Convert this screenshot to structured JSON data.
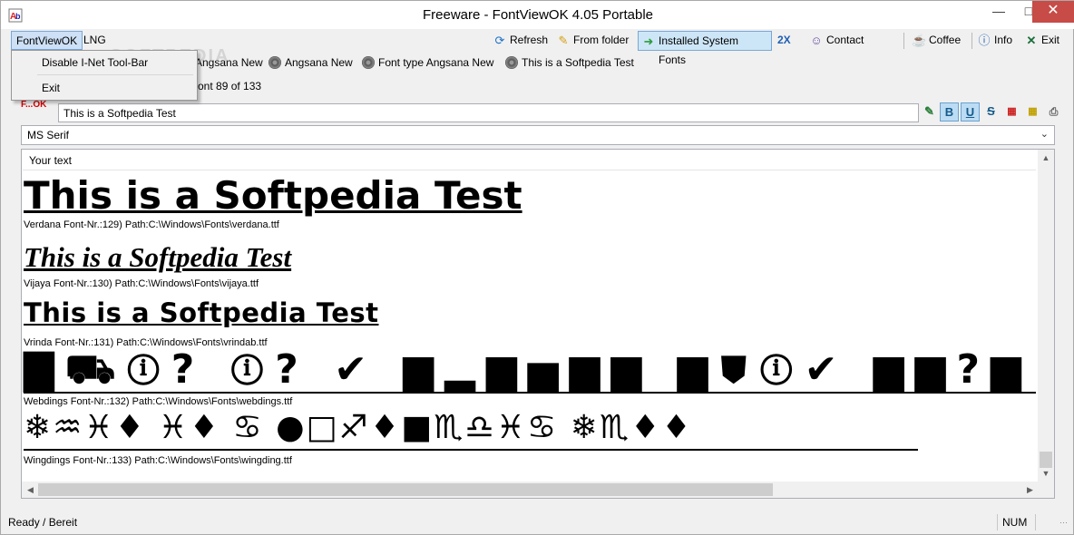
{
  "window": {
    "title": "Freeware - FontViewOK 4.05 Portable"
  },
  "menu": {
    "fontviewok": "FontViewOK",
    "lng": "LNG"
  },
  "dropdown": {
    "item1": "Disable I-Net Tool-Bar",
    "item2": "Exit"
  },
  "toolbar": {
    "refresh": "Refresh",
    "from_folder": "From folder",
    "installed": "Installed System Fonts",
    "twox": "2X",
    "contact": "Contact",
    "coffee": "Coffee",
    "info": "Info",
    "exit": "Exit"
  },
  "recent": [
    "Angsana New",
    "Angsana New",
    "Font type Angsana New",
    "This is a Softpedia Test"
  ],
  "font_info": "ont 89 of 133",
  "input": {
    "value": "This is a Softpedia Test"
  },
  "logo": "F...OK",
  "font_select": {
    "selected": "MS Serif"
  },
  "preview": {
    "header": "Your text",
    "samples": [
      {
        "text": "This is a Softpedia Test",
        "caption": "Verdana Font-Nr.:129) Path:C:\\Windows\\Fonts\\verdana.ttf"
      },
      {
        "text": "This is a Softpedia Test",
        "caption": "Vijaya Font-Nr.:130) Path:C:\\Windows\\Fonts\\vijaya.ttf"
      },
      {
        "text": "This is a Softpedia Test",
        "caption": "Vrinda Font-Nr.:131) Path:C:\\Windows\\Fonts\\vrindab.ttf"
      },
      {
        "text": "▇⛟ⓘ?  ⓘ? ✔ ▆▂▆▅▆▆ ▆⛊ⓘ✔ ▆▆?▆",
        "caption": "Webdings Font-Nr.:132) Path:C:\\Windows\\Fonts\\webdings.ttf"
      },
      {
        "text": "❄♒♓♦  ♓♦  ♋  ●□♐♦■♏♎♓♋  ❄♏♦♦",
        "caption": "Wingdings Font-Nr.:133) Path:C:\\Windows\\Fonts\\wingding.ttf"
      }
    ]
  },
  "status": {
    "text": "Ready / Bereit",
    "num": "NUM"
  },
  "watermark": "SOFTPEDIA",
  "colors": {
    "accent": "#cde0f5",
    "close": "#c74b47"
  }
}
